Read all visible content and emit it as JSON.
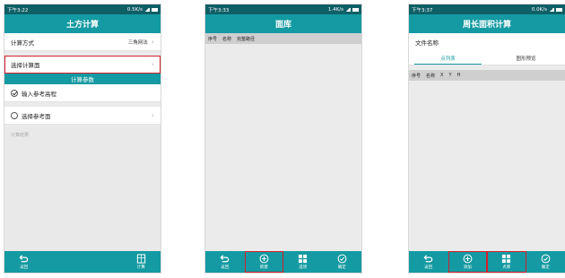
{
  "screen1": {
    "status": {
      "time": "下午3:22",
      "net": "0.5K/s"
    },
    "title": "土方计算",
    "calc_method": {
      "label": "计算方式",
      "value": "三角网法"
    },
    "select_surface": {
      "label": "选择计算面"
    },
    "section_title": "计算参数",
    "input_ref_height": {
      "label": "输入参考高程"
    },
    "select_ref_surface": {
      "label": "选择参考面"
    },
    "result_placeholder": "计算结果",
    "nav": {
      "back": "返回",
      "calc": "计算"
    }
  },
  "screen2": {
    "status": {
      "time": "下午3:33",
      "net": "1.4K/s"
    },
    "title": "面库",
    "columns": [
      "序号",
      "名称",
      "完整路径"
    ],
    "nav": {
      "back": "返回",
      "new": "新建",
      "options": "选项",
      "confirm": "确定"
    }
  },
  "screen3": {
    "status": {
      "time": "下午3:37",
      "net": "0.0K/s"
    },
    "title": "周长面积计算",
    "filename_label": "文件名称",
    "tabs": [
      "点列表",
      "图形预览"
    ],
    "columns": [
      "序号",
      "名称",
      "X",
      "Y",
      "H"
    ],
    "nav": {
      "back": "返回",
      "add": "添加",
      "options": "点库",
      "confirm": "确定"
    }
  },
  "colors": {
    "teal": "#149aa2",
    "dark_teal": "#0f5f66",
    "highlight": "#d21f2b"
  }
}
